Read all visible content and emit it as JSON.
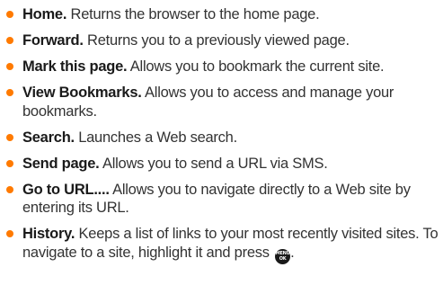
{
  "items": [
    {
      "term": "Home.",
      "desc": " Returns the browser to the  home page."
    },
    {
      "term": "Forward.",
      "desc": " Returns you to a previously viewed page."
    },
    {
      "term": "Mark this page.",
      "desc": " Allows you to bookmark the current site."
    },
    {
      "term": "View Bookmarks.",
      "desc": " Allows you to access and manage your bookmarks."
    },
    {
      "term": "Search.",
      "desc": " Launches a Web search."
    },
    {
      "term": "Send page.",
      "desc": " Allows you to send a URL via SMS."
    },
    {
      "term": "Go to URL....",
      "desc": " Allows you to navigate directly to a Web site by entering its URL."
    },
    {
      "term": "History.",
      "desc": " Keeps a list of links to your most recently visited sites. To navigate to a site, highlight it and press ",
      "desc_after": "."
    }
  ],
  "menu_key": {
    "top": "MENU",
    "bottom": "OK",
    "icon": "menu-ok-key-icon"
  },
  "colors": {
    "bullet": "#ff7a00",
    "text": "#333333",
    "term": "#1a1a1a"
  }
}
